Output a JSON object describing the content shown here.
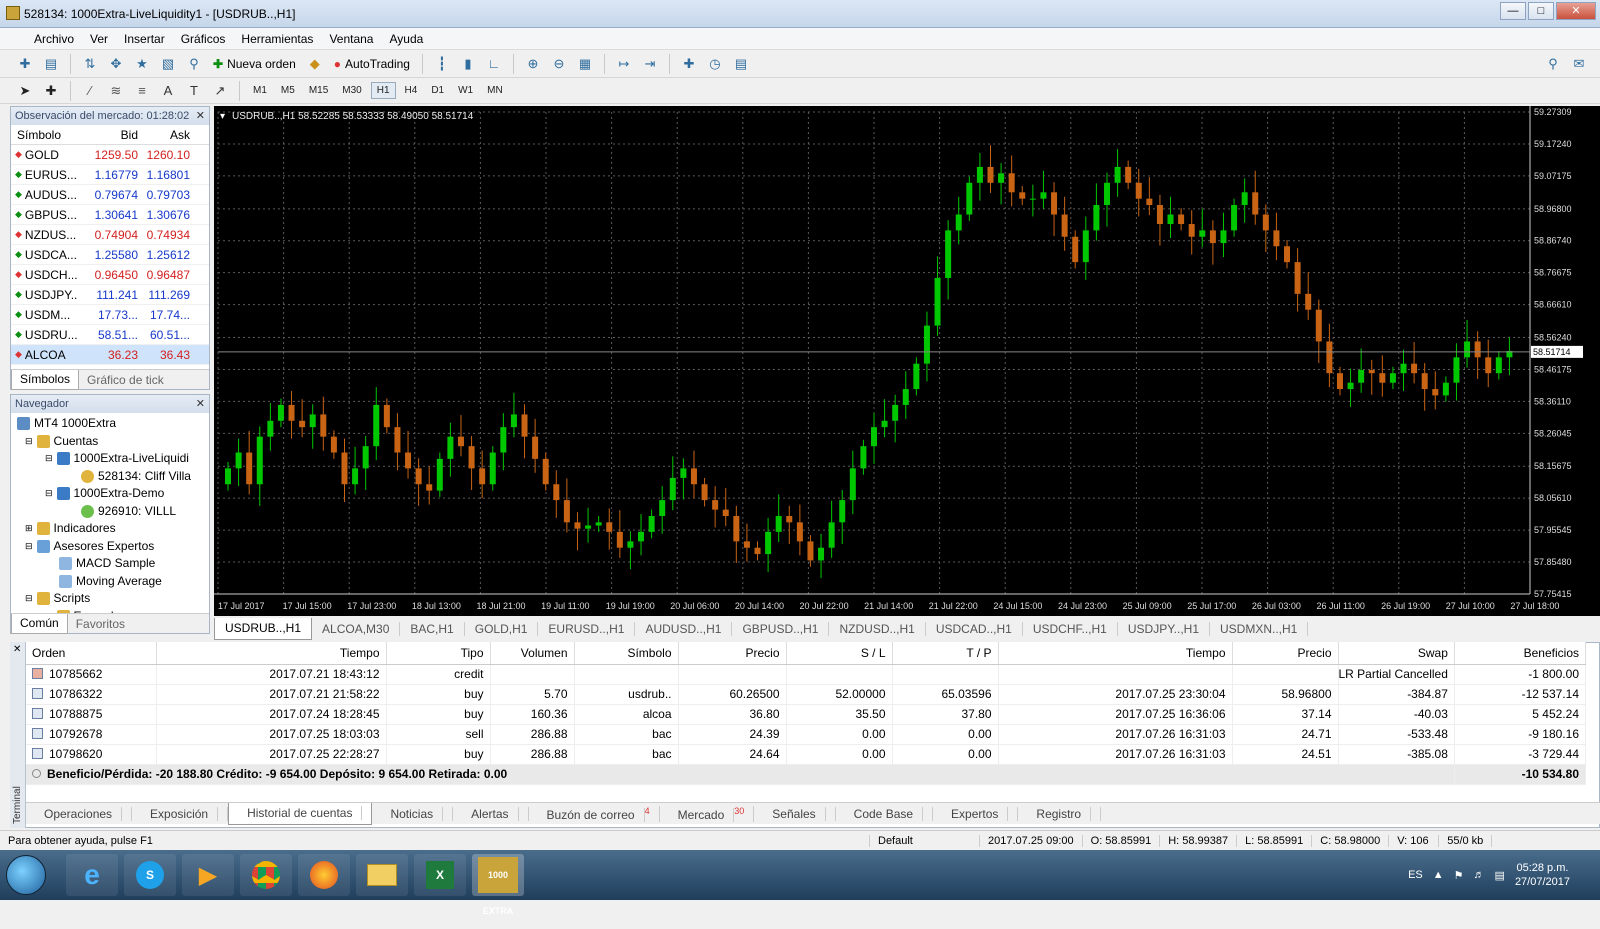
{
  "window": {
    "title": "528134: 1000Extra-LiveLiquidity1 - [USDRUB..,H1]"
  },
  "menu": [
    "Archivo",
    "Ver",
    "Insertar",
    "Gráficos",
    "Herramientas",
    "Ventana",
    "Ayuda"
  ],
  "toolbar": {
    "new_order": "Nueva orden",
    "autotrading": "AutoTrading"
  },
  "timeframes": [
    "M1",
    "M5",
    "M15",
    "M30",
    "H1",
    "H4",
    "D1",
    "W1",
    "MN"
  ],
  "active_timeframe": "H1",
  "market_watch": {
    "title": "Observación del mercado: 01:28:02",
    "headers": {
      "symbol": "Símbolo",
      "bid": "Bid",
      "ask": "Ask"
    },
    "rows": [
      {
        "symbol": "GOLD",
        "bid": "1259.50",
        "ask": "1260.10",
        "dir": "down"
      },
      {
        "symbol": "EURUS...",
        "bid": "1.16779",
        "ask": "1.16801",
        "dir": "up"
      },
      {
        "symbol": "AUDUS...",
        "bid": "0.79674",
        "ask": "0.79703",
        "dir": "up"
      },
      {
        "symbol": "GBPUS...",
        "bid": "1.30641",
        "ask": "1.30676",
        "dir": "up"
      },
      {
        "symbol": "NZDUS...",
        "bid": "0.74904",
        "ask": "0.74934",
        "dir": "down"
      },
      {
        "symbol": "USDCA...",
        "bid": "1.25580",
        "ask": "1.25612",
        "dir": "up"
      },
      {
        "symbol": "USDCH...",
        "bid": "0.96450",
        "ask": "0.96487",
        "dir": "down"
      },
      {
        "symbol": "USDJPY..",
        "bid": "111.241",
        "ask": "111.269",
        "dir": "up"
      },
      {
        "symbol": "USDM...",
        "bid": "17.73...",
        "ask": "17.74...",
        "dir": "up"
      },
      {
        "symbol": "USDRU...",
        "bid": "58.51...",
        "ask": "60.51...",
        "dir": "up"
      },
      {
        "symbol": "ALCOA",
        "bid": "36.23",
        "ask": "36.43",
        "dir": "down"
      }
    ],
    "tabs": [
      "Símbolos",
      "Gráfico de tick"
    ]
  },
  "navigator": {
    "title": "Navegador",
    "items": [
      "MT4 1000Extra",
      "Cuentas",
      "1000Extra-LiveLiquidi",
      "528134: Cliff Villa",
      "1000Extra-Demo",
      "926910: VILLL",
      "Indicadores",
      "Asesores Expertos",
      "MACD Sample",
      "Moving Average",
      "Scripts",
      "Examples"
    ],
    "tabs": [
      "Común",
      "Favoritos"
    ]
  },
  "chart_data": {
    "type": "candlestick",
    "header": "USDRUB..,H1  58.52285 58.53333 58.49050 58.51714",
    "y_ticks": [
      "59.27309",
      "59.17240",
      "59.07175",
      "58.96800",
      "58.86740",
      "58.76675",
      "58.66610",
      "58.56240",
      "58.46175",
      "58.36110",
      "58.26045",
      "58.15675",
      "58.05610",
      "57.95545",
      "57.85480",
      "57.75415"
    ],
    "current_price": "58.51714",
    "x_ticks": [
      "17 Jul 2017",
      "17 Jul 15:00",
      "17 Jul 23:00",
      "18 Jul 13:00",
      "18 Jul 21:00",
      "19 Jul 11:00",
      "19 Jul 19:00",
      "20 Jul 06:00",
      "20 Jul 14:00",
      "20 Jul 22:00",
      "21 Jul 14:00",
      "21 Jul 22:00",
      "24 Jul 15:00",
      "24 Jul 23:00",
      "25 Jul 09:00",
      "25 Jul 17:00",
      "26 Jul 03:00",
      "26 Jul 11:00",
      "26 Jul 19:00",
      "27 Jul 10:00",
      "27 Jul 18:00"
    ],
    "y_range": [
      57.75415,
      59.27309
    ],
    "closes": [
      58.15,
      58.2,
      58.1,
      58.25,
      58.3,
      58.35,
      58.3,
      58.28,
      58.32,
      58.25,
      58.2,
      58.1,
      58.15,
      58.22,
      58.35,
      58.28,
      58.2,
      58.15,
      58.1,
      58.08,
      58.18,
      58.25,
      58.22,
      58.15,
      58.1,
      58.2,
      58.28,
      58.32,
      58.25,
      58.18,
      58.1,
      58.05,
      57.98,
      57.96,
      57.97,
      57.98,
      57.95,
      57.9,
      57.92,
      57.95,
      58.0,
      58.05,
      58.12,
      58.15,
      58.1,
      58.05,
      58.02,
      58.0,
      57.92,
      57.9,
      57.88,
      57.95,
      58.0,
      57.98,
      57.92,
      57.86,
      57.9,
      57.98,
      58.05,
      58.15,
      58.22,
      58.28,
      58.3,
      58.35,
      58.4,
      58.48,
      58.6,
      58.75,
      58.9,
      58.95,
      59.05,
      59.1,
      59.05,
      59.08,
      59.02,
      59.0,
      59.0,
      59.02,
      58.95,
      58.88,
      58.8,
      58.9,
      58.98,
      59.05,
      59.1,
      59.05,
      59.0,
      58.98,
      58.92,
      58.95,
      58.92,
      58.88,
      58.9,
      58.86,
      58.9,
      58.98,
      59.02,
      58.95,
      58.9,
      58.85,
      58.8,
      58.7,
      58.65,
      58.55,
      58.45,
      58.4,
      58.42,
      58.46,
      58.45,
      58.42,
      58.45,
      58.48,
      58.45,
      58.4,
      58.38,
      58.42,
      58.5,
      58.55,
      58.5,
      58.45,
      58.5,
      58.52
    ]
  },
  "chart_tabs": [
    "USDRUB..,H1",
    "ALCOA,M30",
    "BAC,H1",
    "GOLD,H1",
    "EURUSD..,H1",
    "AUDUSD..,H1",
    "GBPUSD..,H1",
    "NZDUSD..,H1",
    "USDCAD..,H1",
    "USDCHF..,H1",
    "USDJPY..,H1",
    "USDMXN..,H1"
  ],
  "terminal": {
    "headers": [
      "Orden",
      "Tiempo",
      "Tipo",
      "Volumen",
      "Símbolo",
      "Precio",
      "S / L",
      "T / P",
      "Tiempo",
      "Precio",
      "Swap",
      "Beneficios"
    ],
    "rows": [
      [
        "10785662",
        "2017.07.21 18:43:12",
        "credit",
        "",
        "",
        "",
        "",
        "",
        "",
        "",
        "LR Partial Cancelled",
        "-1 800.00"
      ],
      [
        "10786322",
        "2017.07.21 21:58:22",
        "buy",
        "5.70",
        "usdrub..",
        "60.26500",
        "52.00000",
        "65.03596",
        "2017.07.25 23:30:04",
        "58.96800",
        "-384.87",
        "-12 537.14"
      ],
      [
        "10788875",
        "2017.07.24 18:28:45",
        "buy",
        "160.36",
        "alcoa",
        "36.80",
        "35.50",
        "37.80",
        "2017.07.25 16:36:06",
        "37.14",
        "-40.03",
        "5 452.24"
      ],
      [
        "10792678",
        "2017.07.25 18:03:03",
        "sell",
        "286.88",
        "bac",
        "24.39",
        "0.00",
        "0.00",
        "2017.07.26 16:31:03",
        "24.71",
        "-533.48",
        "-9 180.16"
      ],
      [
        "10798620",
        "2017.07.25 22:28:27",
        "buy",
        "286.88",
        "bac",
        "24.64",
        "0.00",
        "0.00",
        "2017.07.26 16:31:03",
        "24.51",
        "-385.08",
        "-3 729.44"
      ]
    ],
    "summary": "Beneficio/Pérdida: -20 188.80  Crédito: -9 654.00  Depósito: 9 654.00  Retirada: 0.00",
    "summary_total": "-10 534.80",
    "side_label": "Terminal",
    "tabs": [
      "Operaciones",
      "Exposición",
      "Historial de cuentas",
      "Noticias",
      "Alertas",
      "Buzón de correo",
      "Mercado",
      "Señales",
      "Code Base",
      "Expertos",
      "Registro"
    ],
    "badges": {
      "mail": "4",
      "market": "30"
    }
  },
  "statusbar": [
    "Para obtener ayuda, pulse F1",
    "Default",
    "2017.07.25 09:00",
    "O: 58.85991",
    "H: 58.99387",
    "L: 58.85991",
    "C: 58.98000",
    "V: 106",
    "55/0 kb"
  ],
  "taskbar": {
    "lang": "ES",
    "time": "05:28 p.m.",
    "date": "27/07/2017",
    "app_label": "1000 EXTRA"
  }
}
